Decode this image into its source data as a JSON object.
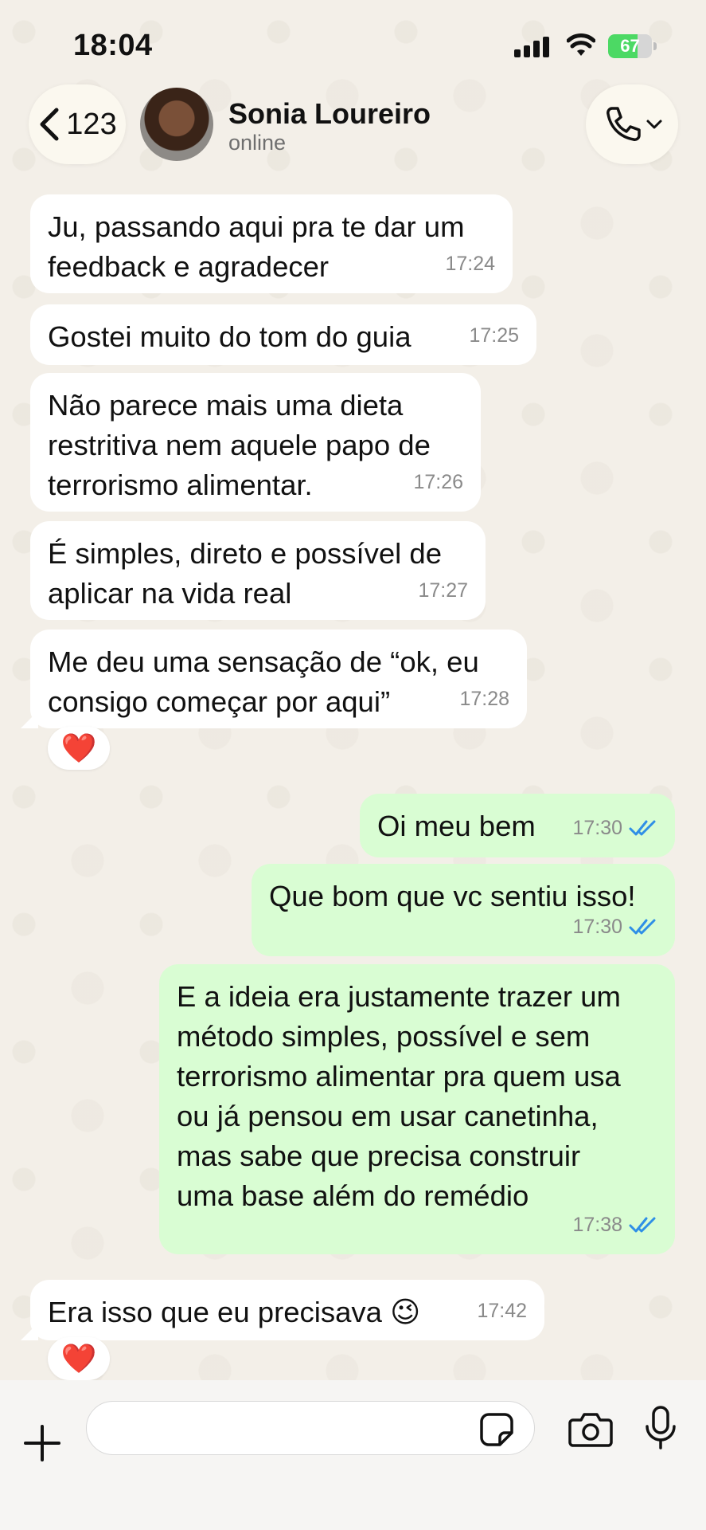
{
  "status_bar": {
    "time": "18:04",
    "battery_level": "67",
    "battery_fraction": 0.67
  },
  "header": {
    "back_count": "123",
    "contact_name": "Sonia Loureiro",
    "contact_status": "online"
  },
  "messages": [
    {
      "direction": "in",
      "text": "Ju, passando aqui pra te dar um\nfeedback e agradecer",
      "time": "17:24"
    },
    {
      "direction": "in",
      "text": "Gostei muito do tom do guia",
      "time": "17:25"
    },
    {
      "direction": "in",
      "text": "Não parece mais uma dieta\nrestritiva nem aquele papo de\nterrorismo alimentar.",
      "time": "17:26"
    },
    {
      "direction": "in",
      "text": "É simples, direto e possível de\naplicar na vida real",
      "time": "17:27"
    },
    {
      "direction": "in",
      "text": "Me deu uma sensação de “ok, eu\nconsigo começar por aqui”",
      "time": "17:28",
      "reaction": "❤️"
    },
    {
      "direction": "out",
      "text": "Oi meu bem",
      "time": "17:30",
      "status": "read"
    },
    {
      "direction": "out",
      "text": "Que bom que vc sentiu isso!",
      "time": "17:30",
      "status": "read"
    },
    {
      "direction": "out",
      "text": "E a ideia era justamente trazer um\nmétodo simples, possível e sem\nterrorismo alimentar pra quem usa\nou já pensou em usar canetinha,\nmas sabe que precisa construir\numa base além do remédio",
      "time": "17:38",
      "status": "read"
    },
    {
      "direction": "in",
      "text": "Era isso que eu precisava 😉",
      "time": "17:42",
      "reaction": "❤️"
    }
  ],
  "input": {
    "placeholder": ""
  },
  "colors": {
    "background": "#f3efe8",
    "incoming_bubble": "#ffffff",
    "outgoing_bubble": "#d9fdd3",
    "read_ticks": "#2f8fe6",
    "battery_green": "#4cd964"
  },
  "icons": {
    "back": "chevron-left-icon",
    "call": "phone-icon",
    "call_menu": "chevron-down-icon",
    "attach": "plus-icon",
    "sticker": "sticker-icon",
    "camera": "camera-icon",
    "mic": "microphone-icon",
    "read": "double-check-icon"
  }
}
